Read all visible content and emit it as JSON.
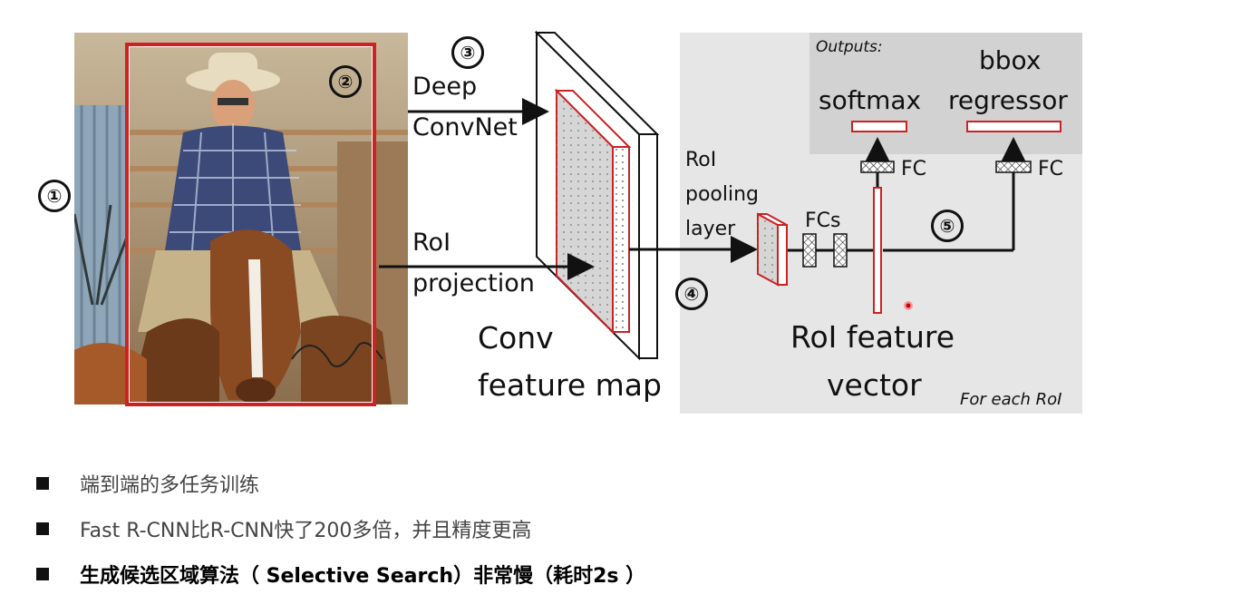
{
  "markers": [
    "①",
    "②",
    "③",
    "④",
    "⑤"
  ],
  "labels": {
    "deep_convnet": [
      "Deep",
      "ConvNet"
    ],
    "roi_projection": [
      "RoI",
      "projection"
    ],
    "conv_feature_map": [
      "Conv",
      "feature map"
    ],
    "roi_pooling_layer": [
      "RoI",
      "pooling",
      "layer"
    ],
    "fcs": "FCs",
    "fc": "FC",
    "outputs": "Outputs:",
    "softmax": "softmax",
    "bbox_regressor": [
      "bbox",
      "regressor"
    ],
    "roi_feature_vector": [
      "RoI feature",
      "vector"
    ],
    "for_each_roi": "For each RoI"
  },
  "colors": {
    "accent_red": "#cc2222",
    "panel_gray": "#e6e6e6",
    "outputs_gray": "#d2d2d2"
  },
  "bullets": [
    {
      "text": "端到端的多任务训练",
      "strong": false
    },
    {
      "text": "Fast R-CNN比R-CNN快了200多倍，并且精度更高",
      "strong": false
    },
    {
      "text": "生成候选区域算法（ Selective Search）非常慢（耗时2s ）",
      "strong": true
    }
  ]
}
